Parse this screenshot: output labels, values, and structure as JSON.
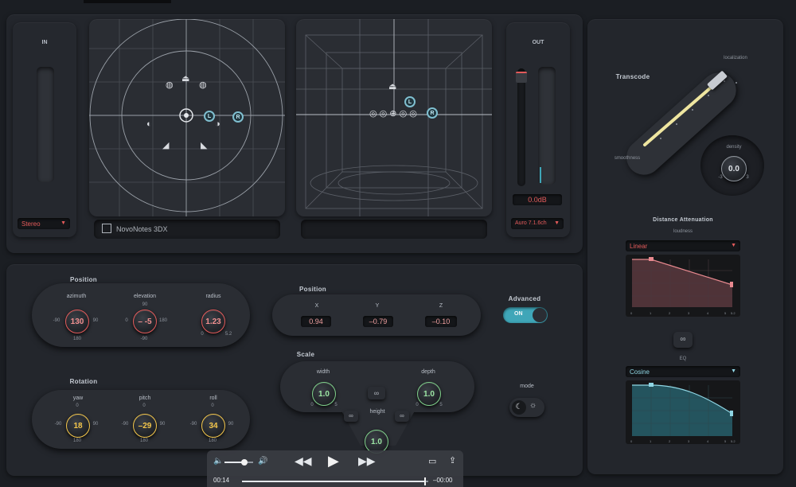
{
  "input": {
    "label": "IN",
    "format": "Stereo"
  },
  "output": {
    "label": "OUT",
    "level": "0.0dB",
    "format": "Auro 7.1.6ch",
    "meter_level": 0.2
  },
  "brand": {
    "name": "NovoNotes 3DX"
  },
  "badges": {
    "left": "L",
    "right": "R"
  },
  "transcode": {
    "title": "Transcode",
    "top_label": "localization",
    "bottom_label": "smoothness",
    "value": 0.88
  },
  "density": {
    "label": "density",
    "value": "0.0",
    "min": "-3",
    "max": "3"
  },
  "distance_attenuation": {
    "title": "Distance Attenuation",
    "subtitle": "loudness",
    "curve": "Linear",
    "eq_label": "EQ",
    "eq_curve": "Cosine",
    "axis_ticks": [
      "0",
      "1",
      "2",
      "3",
      "4",
      "5",
      "5.2"
    ]
  },
  "polar_position": {
    "title": "Position",
    "azimuth": {
      "label": "azimuth",
      "value": "130",
      "min": "-90",
      "max": "90",
      "bottom": "180",
      "top": "0"
    },
    "elevation": {
      "label": "elevation",
      "value": "– -5",
      "min": "0",
      "max": "180",
      "top": "90",
      "bottom": "-90"
    },
    "radius": {
      "label": "radius",
      "value": "1.23",
      "min": "0",
      "max": "5.2"
    }
  },
  "cartesian_position": {
    "title": "Position",
    "x_label": "X",
    "x": "0.94",
    "y_label": "Y",
    "y": "–0.79",
    "z_label": "Z",
    "z": "–0.10"
  },
  "advanced": {
    "label": "Advanced",
    "state": "ON"
  },
  "scale": {
    "title": "Scale",
    "width_label": "width",
    "width": "1.0",
    "depth_label": "depth",
    "depth": "1.0",
    "height_label": "height",
    "height": "1.0",
    "min": "0",
    "max": "5"
  },
  "mode": {
    "label": "mode"
  },
  "rotation": {
    "title": "Rotation",
    "yaw": {
      "label": "yaw",
      "value": "18",
      "top": "0",
      "min": "-90",
      "max": "90",
      "bottom": "180"
    },
    "pitch": {
      "label": "pitch",
      "value": "–29",
      "top": "0",
      "min": "-90",
      "max": "90",
      "bottom": "180"
    },
    "roll": {
      "label": "roll",
      "value": "34",
      "top": "0",
      "min": "-90",
      "max": "90",
      "bottom": "180"
    }
  },
  "player": {
    "elapsed": "00:14",
    "remaining": "–00:00",
    "volume": 0.7,
    "progress": 0.98
  },
  "colors": {
    "accent_red": "#e35a5a",
    "accent_teal": "#3fa6b8",
    "knob_yellow": "#f3c64b",
    "knob_green": "#7fd08a"
  }
}
